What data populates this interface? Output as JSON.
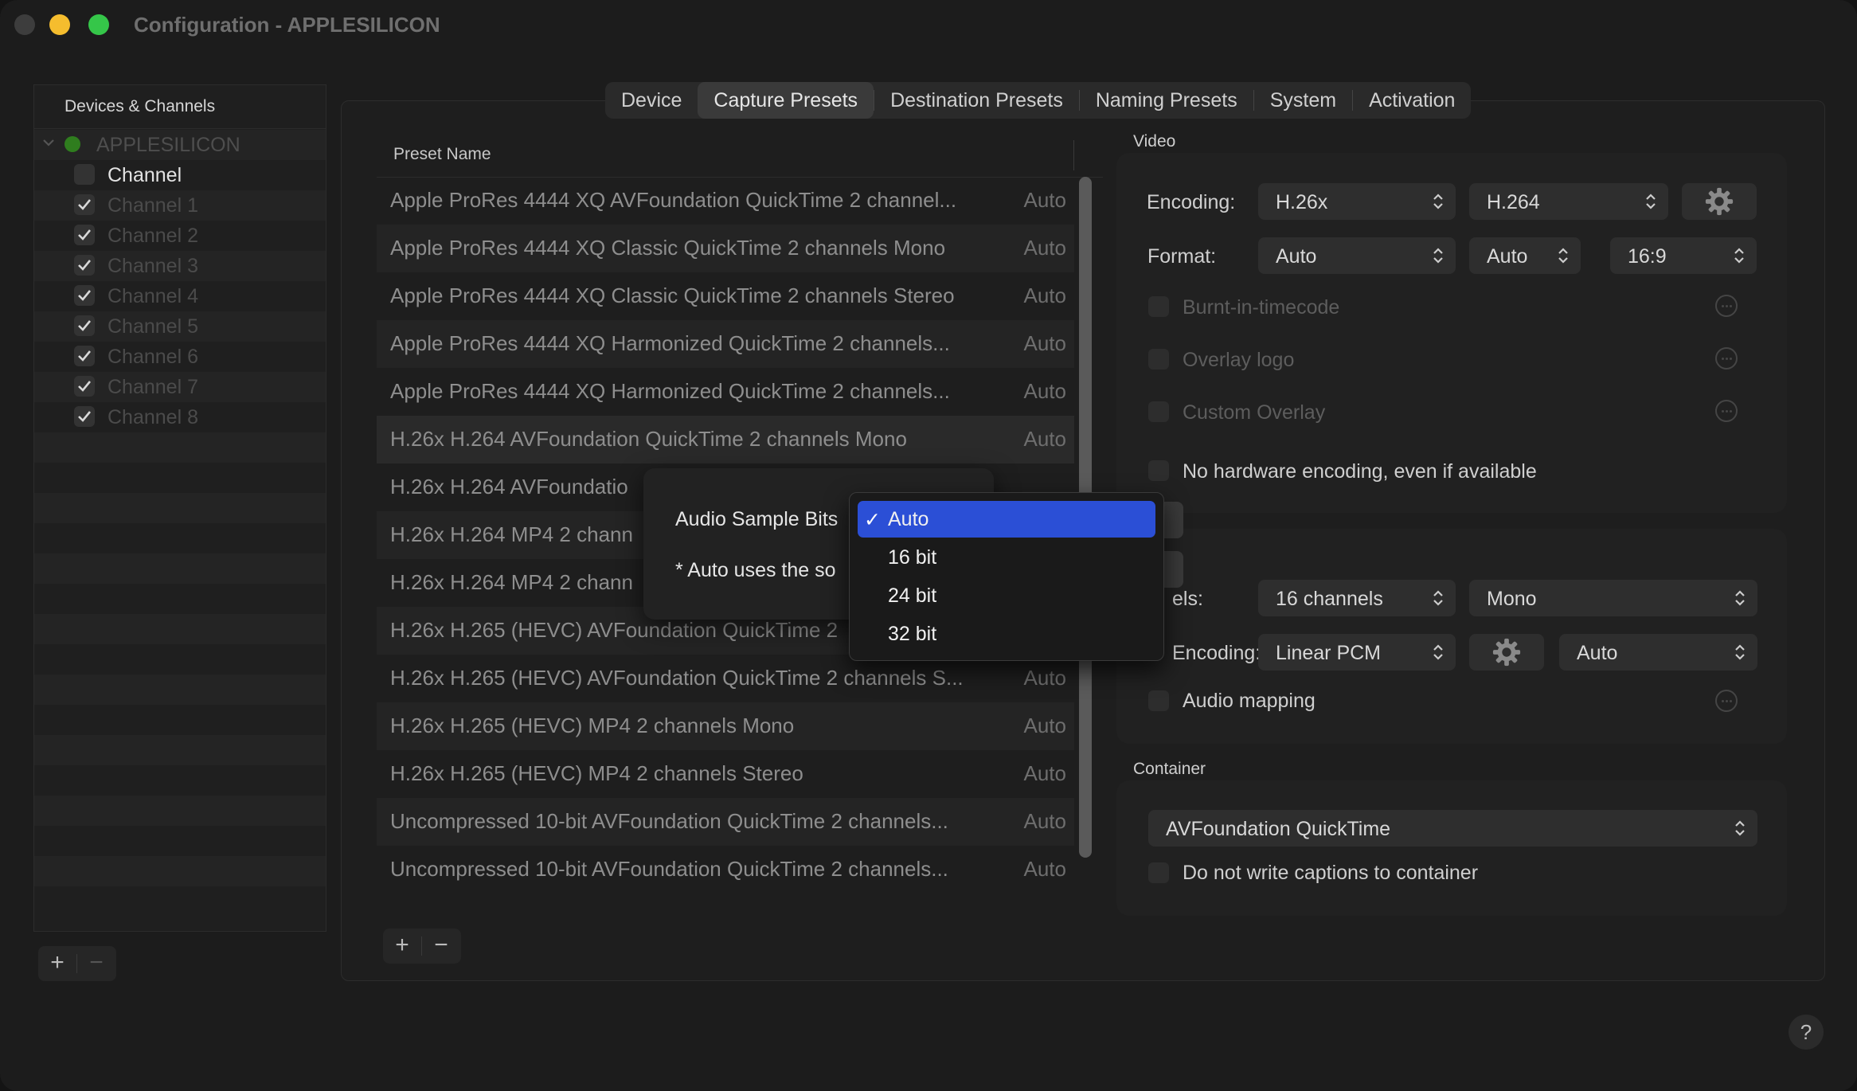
{
  "window": {
    "title": "Configuration - APPLESILICON"
  },
  "sidebar": {
    "header": "Devices & Channels",
    "device": "APPLESILICON",
    "channel_header": "Channel",
    "channels": [
      "Channel 1",
      "Channel 2",
      "Channel 3",
      "Channel 4",
      "Channel 5",
      "Channel 6",
      "Channel 7",
      "Channel 8"
    ],
    "add_label": "+",
    "remove_label": "−"
  },
  "tabs": [
    "Device",
    "Capture Presets",
    "Destination Presets",
    "Naming Presets",
    "System",
    "Activation"
  ],
  "active_tab": "Capture Presets",
  "presets": {
    "column_header": "Preset Name",
    "rows": [
      {
        "name": "Apple ProRes 4444 XQ AVFoundation QuickTime 2 channel...",
        "value": "Auto"
      },
      {
        "name": "Apple ProRes 4444 XQ Classic QuickTime 2 channels Mono",
        "value": "Auto"
      },
      {
        "name": "Apple ProRes 4444 XQ Classic QuickTime 2 channels Stereo",
        "value": "Auto"
      },
      {
        "name": "Apple ProRes 4444 XQ Harmonized QuickTime 2 channels...",
        "value": "Auto"
      },
      {
        "name": "Apple ProRes 4444 XQ Harmonized QuickTime 2 channels...",
        "value": "Auto"
      },
      {
        "name": "H.26x H.264 AVFoundation QuickTime 2 channels Mono",
        "value": "Auto"
      },
      {
        "name": "H.26x H.264 AVFoundatio",
        "value": ""
      },
      {
        "name": "H.26x H.264 MP4 2 chann",
        "value": ""
      },
      {
        "name": "H.26x H.264 MP4 2 chann",
        "value": ""
      },
      {
        "name": "H.26x H.265 (HEVC) AVFoundation QuickTime 2",
        "value": ""
      },
      {
        "name": "H.26x H.265 (HEVC) AVFoundation QuickTime 2 channels S...",
        "value": "Auto"
      },
      {
        "name": "H.26x H.265 (HEVC) MP4 2 channels Mono",
        "value": "Auto"
      },
      {
        "name": "H.26x H.265 (HEVC) MP4 2 channels Stereo",
        "value": "Auto"
      },
      {
        "name": "Uncompressed 10-bit AVFoundation QuickTime 2 channels...",
        "value": "Auto"
      },
      {
        "name": "Uncompressed 10-bit AVFoundation QuickTime 2 channels...",
        "value": "Auto"
      }
    ],
    "add_label": "+",
    "remove_label": "−"
  },
  "video": {
    "title": "Video",
    "encoding_label": "Encoding:",
    "encoding_family": "H.26x",
    "encoding_codec": "H.264",
    "format_label": "Format:",
    "format_1": "Auto",
    "format_2": "Auto",
    "format_3": "16:9",
    "burnt_in": "Burnt-in-timecode",
    "overlay_logo": "Overlay logo",
    "custom_overlay": "Custom Overlay",
    "no_hw": "No hardware encoding, even if available"
  },
  "audio": {
    "channels_label": "els:",
    "channels_value": "16 channels",
    "layout_value": "Mono",
    "encoding_label": "Encoding:",
    "encoding_value": "Linear PCM",
    "rate_value": "Auto",
    "mapping": "Audio mapping"
  },
  "container": {
    "title": "Container",
    "value": "AVFoundation QuickTime",
    "no_captions": "Do not write captions to container"
  },
  "dialog": {
    "sample_bits_label": "Audio Sample Bits",
    "note": "* Auto uses the so"
  },
  "menu": {
    "check": "✓",
    "options": [
      "Auto",
      "16 bit",
      "24 bit",
      "32 bit"
    ],
    "selected": "Auto"
  },
  "help_label": "?",
  "colors": {
    "accent": "#2b4fd6",
    "close": "#3d3d3d",
    "minimize": "#f5bd2e",
    "zoom": "#35c649"
  }
}
